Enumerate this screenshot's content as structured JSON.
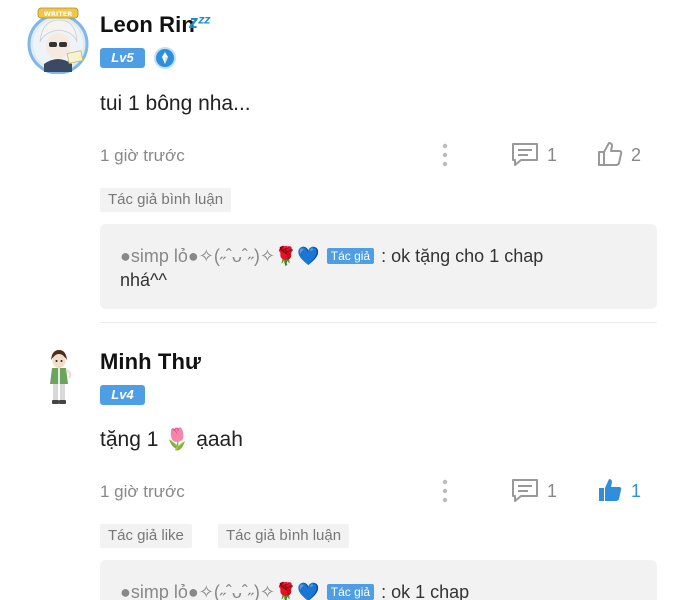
{
  "comments": [
    {
      "author": "Leon Rin",
      "status_suffix": "zᶻᶻ",
      "level": "Lv5",
      "text": "tui 1 bông nha...",
      "time": "1 giờ trước",
      "reply_count": "1",
      "like_count": "2",
      "liked": false,
      "tags": [
        "Tác giả bình luận"
      ],
      "reply": {
        "user": "●simp lỏ●✧(˶ˆᴗˆ˶)✧🌹💙",
        "badge": "Tác giả",
        "text": ": ok tặng cho 1 chap",
        "text_line2": "nhá^^"
      }
    },
    {
      "author": "Minh Thư",
      "level": "Lv4",
      "text": "tặng 1 🌷 ạaah",
      "time": "1 giờ trước",
      "reply_count": "1",
      "like_count": "1",
      "liked": true,
      "tags": [
        "Tác giả like",
        "Tác giả bình luận"
      ],
      "reply": {
        "user": "●simp lỏ●✧(˶ˆᴗˆ˶)✧🌹💙",
        "badge": "Tác giả",
        "text": ": ok 1 chap"
      }
    }
  ],
  "icons": {
    "more": "vertical-dots-icon",
    "reply": "comment-icon",
    "like": "thumbs-up-icon",
    "verified": "verified-badge-icon"
  },
  "colors": {
    "accent": "#2f8fdd",
    "level_badge": "#4e9ee6",
    "muted_text": "#888888",
    "tag_bg": "#f2f2f2"
  }
}
